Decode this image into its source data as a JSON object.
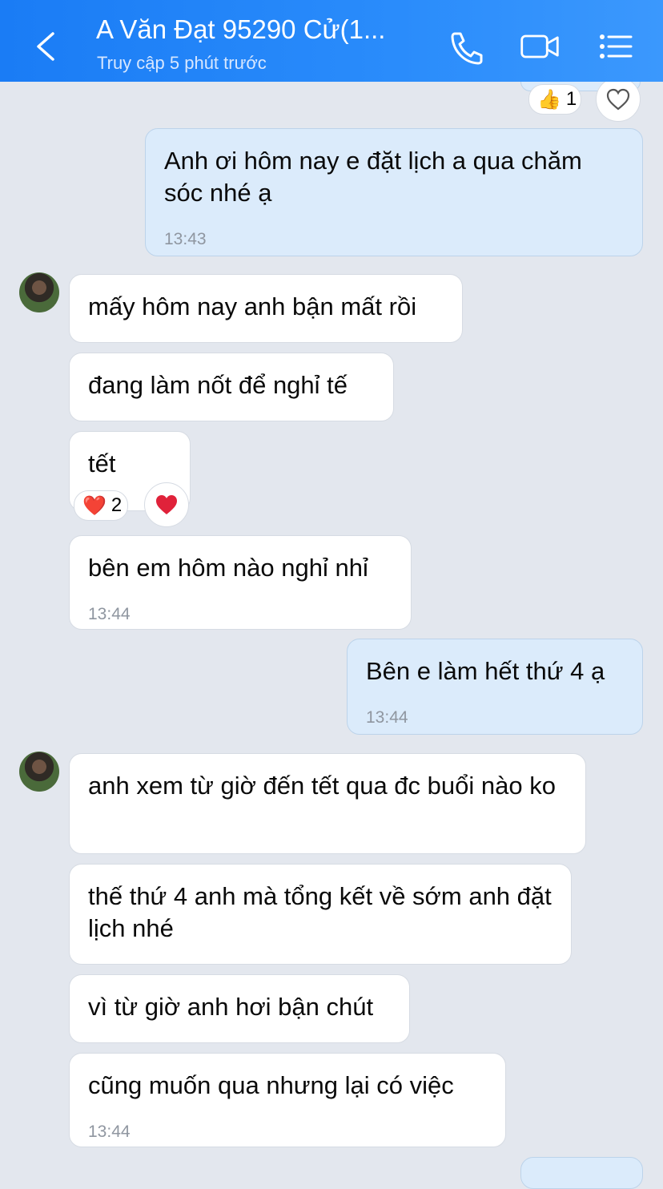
{
  "header": {
    "title": "A Văn Đạt 95290 Cử(1...",
    "status": "Truy cập 5 phút trước",
    "accent": "#2a8cfb"
  },
  "top_reaction": {
    "emoji": "👍",
    "count": "1"
  },
  "messages": [
    {
      "from": "me",
      "text": "Anh ơi hôm nay e đặt lịch a qua chăm sóc nhé ạ",
      "time": "13:43"
    },
    {
      "from": "them",
      "text": "mấy hôm nay anh bận mất rồi"
    },
    {
      "from": "them",
      "text": "đang làm nốt để nghỉ tế"
    },
    {
      "from": "them",
      "text": "tết",
      "reaction_emoji": "❤️",
      "reaction_count": "2"
    },
    {
      "from": "them",
      "text": "bên em hôm nào nghỉ nhỉ",
      "time": "13:44"
    },
    {
      "from": "me",
      "text": "Bên e làm hết thứ 4 ạ",
      "time": "13:44"
    },
    {
      "from": "them",
      "text": "anh xem từ giờ đến tết qua đc buổi nào ko"
    },
    {
      "from": "them",
      "text": "thế thứ 4 anh mà tổng kết về sớm anh đặt lịch nhé"
    },
    {
      "from": "them",
      "text": "vì từ giờ anh hơi bận chút"
    },
    {
      "from": "them",
      "text": "cũng muốn qua nhưng lại có việc",
      "time": "13:44"
    }
  ],
  "icons": {
    "back": "chevron-left-icon",
    "call": "phone-icon",
    "video": "video-camera-icon",
    "menu": "list-menu-icon",
    "like": "heart-outline-icon",
    "heart": "heart-icon"
  }
}
